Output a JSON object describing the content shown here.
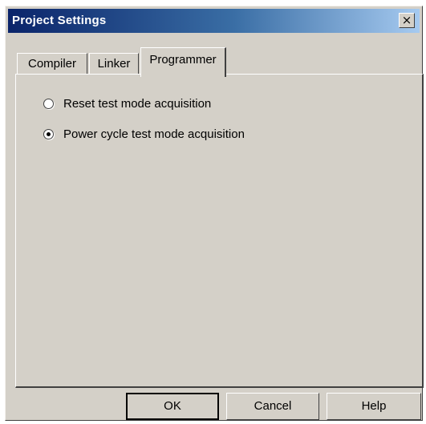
{
  "window": {
    "title": "Project Settings",
    "close_glyph": "×"
  },
  "tabs": [
    {
      "label": "Compiler",
      "active": false
    },
    {
      "label": "Linker",
      "active": false
    },
    {
      "label": "Programmer",
      "active": true
    }
  ],
  "options": [
    {
      "label": "Reset test mode acquisition",
      "selected": false
    },
    {
      "label": "Power cycle test mode acquisition",
      "selected": true
    }
  ],
  "buttons": {
    "ok": "OK",
    "cancel": "Cancel",
    "help": "Help"
  },
  "icons": {
    "close": "close-icon",
    "radio": "radio-icon"
  },
  "colors": {
    "titlebar_start": "#0a246a",
    "titlebar_end": "#a6caf0",
    "face": "#d4d0c8"
  }
}
